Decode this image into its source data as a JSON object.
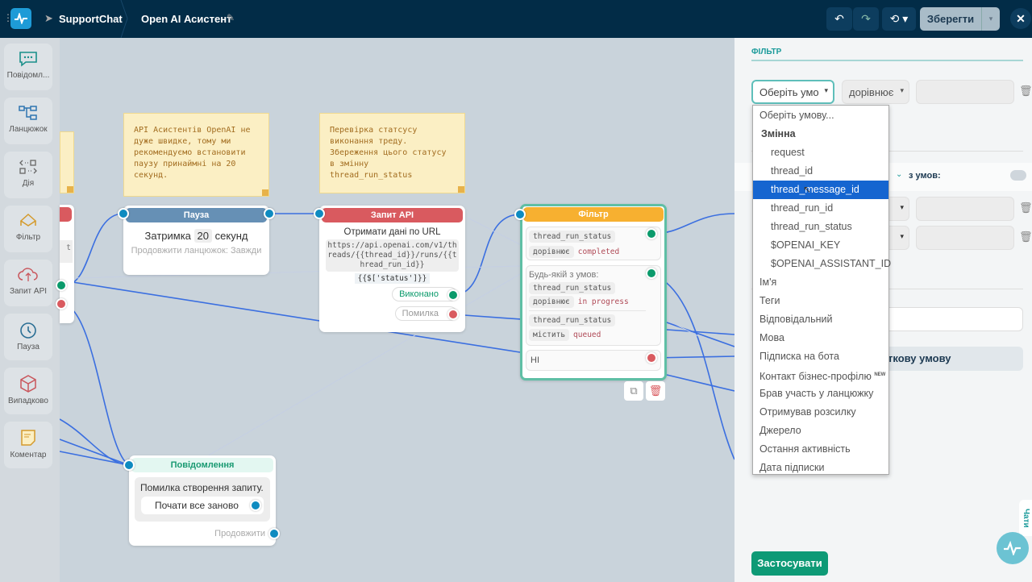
{
  "topbar": {
    "bot_name": "SupportChat",
    "flow_title": "Open AI Асистент",
    "save_label": "Зберегти"
  },
  "sidebar": {
    "items": [
      {
        "label": "Повідомл...",
        "icon": "chat-bubble-icon"
      },
      {
        "label": "Ланцюжок",
        "icon": "chain-icon"
      },
      {
        "label": "Дія",
        "icon": "action-icon"
      },
      {
        "label": "Фільтр",
        "icon": "filter-icon"
      },
      {
        "label": "Запит API",
        "icon": "cloud-api-icon"
      },
      {
        "label": "Пауза",
        "icon": "clock-icon"
      },
      {
        "label": "Випадково",
        "icon": "dice-icon"
      },
      {
        "label": "Коментар",
        "icon": "note-icon"
      }
    ]
  },
  "canvas": {
    "partial_node_text": "t",
    "note1": "API Асистентів OpenAI не дуже швидке, тому ми рекомендуємо встановити паузу принаймні на 20 секунд.",
    "note2": "Перевірка статсусу виконання треду. Збереження цього статусу в змінну thread_run_status",
    "pause": {
      "title": "Пауза",
      "delay_prefix": "Затримка",
      "delay_value": "20",
      "delay_unit": "секунд",
      "continue": "Продовжити ланцюжок: Завжди"
    },
    "api": {
      "title": "Запит API",
      "subtitle": "Отримати дані по URL",
      "url": "https://api.openai.com/v1/threads/{{thread_id}}/runs/{{thread_run_id}}",
      "path": "{{$['status']}}",
      "success": "Виконано",
      "error": "Помилка"
    },
    "filter": {
      "title": "Фільтр",
      "cond1": {
        "var": "thread_run_status",
        "op": "дорівнює",
        "value": "completed"
      },
      "any_label": "Будь-якій з умов:",
      "cond2": {
        "var": "thread_run_status",
        "op": "дорівнює",
        "value": "in progress"
      },
      "cond3": {
        "var": "thread_run_status",
        "op": "містить",
        "value": "queued"
      },
      "else": "НІ"
    },
    "message": {
      "title": "Повідомлення",
      "text": "Помилка створення запиту.",
      "button": "Почати все заново",
      "continue": "Продовжити"
    }
  },
  "panel": {
    "section_title": "ФІЛЬТР",
    "condition_select": "Оберіть умо",
    "operator_select": "дорівнює",
    "any_of_suffix": "з умов:",
    "add_condition_partial": "ткову умову",
    "apply": "Застосувати",
    "chats_tab": "Чати"
  },
  "dropdown": {
    "placeholder": "Оберіть умову...",
    "group": "Змінна",
    "variables": [
      "request",
      "thread_id",
      "thread_message_id",
      "thread_run_id",
      "thread_run_status",
      "$OPENAI_KEY",
      "$OPENAI_ASSISTANT_ID"
    ],
    "selected": "thread_message_id",
    "others": [
      "Ім'я",
      "Теги",
      "Відповідальний",
      "Мова",
      "Підписка на бота",
      "Контакт бізнес-профілю",
      "Брав участь у ланцюжку",
      "Отримував розсилку",
      "Джерело",
      "Остання активність",
      "Дата підписки"
    ],
    "new_badge": "NEW"
  },
  "colors": {
    "header": "#022c47",
    "accent": "#0e9a76",
    "link_line": "#3b6fe0",
    "selected": "#1565d0"
  }
}
